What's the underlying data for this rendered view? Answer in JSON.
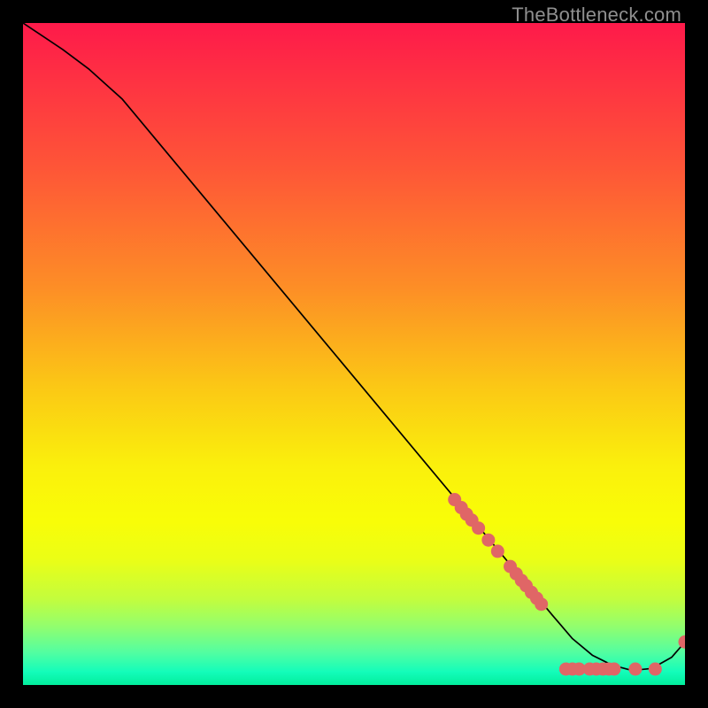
{
  "watermark": "TheBottleneck.com",
  "chart_data": {
    "type": "line",
    "title": "",
    "xlabel": "",
    "ylabel": "",
    "xlim": [
      0,
      100
    ],
    "ylim": [
      0,
      100
    ],
    "grid": false,
    "series": [
      {
        "name": "curve",
        "x": [
          0,
          3,
          6,
          10,
          15,
          20,
          25,
          30,
          35,
          40,
          45,
          50,
          55,
          60,
          65,
          70,
          75,
          80,
          83,
          86,
          89,
          92,
          95,
          98,
          100
        ],
        "y": [
          100,
          98,
          96,
          93,
          88.5,
          82.5,
          76.5,
          70.5,
          64.5,
          58.5,
          52.5,
          46.5,
          40.5,
          34.5,
          28.5,
          22.5,
          16.5,
          10.5,
          7,
          4.5,
          3,
          2.2,
          2.5,
          4.2,
          6.5
        ],
        "stroke": "#000000",
        "stroke_width": 1.7
      }
    ],
    "markers": {
      "color": "#e06666",
      "radius": 7.5,
      "points": [
        {
          "x": 65.2,
          "y": 28.0
        },
        {
          "x": 66.2,
          "y": 26.8
        },
        {
          "x": 67.0,
          "y": 25.8
        },
        {
          "x": 67.8,
          "y": 24.9
        },
        {
          "x": 68.8,
          "y": 23.7
        },
        {
          "x": 70.3,
          "y": 21.9
        },
        {
          "x": 71.7,
          "y": 20.2
        },
        {
          "x": 73.6,
          "y": 17.9
        },
        {
          "x": 74.5,
          "y": 16.8
        },
        {
          "x": 75.3,
          "y": 15.8
        },
        {
          "x": 76.0,
          "y": 15.0
        },
        {
          "x": 76.8,
          "y": 14.0
        },
        {
          "x": 77.6,
          "y": 13.1
        },
        {
          "x": 78.3,
          "y": 12.2
        },
        {
          "x": 82.0,
          "y": 2.4
        },
        {
          "x": 83.0,
          "y": 2.4
        },
        {
          "x": 84.0,
          "y": 2.4
        },
        {
          "x": 85.6,
          "y": 2.4
        },
        {
          "x": 86.6,
          "y": 2.4
        },
        {
          "x": 87.6,
          "y": 2.4
        },
        {
          "x": 88.5,
          "y": 2.4
        },
        {
          "x": 89.3,
          "y": 2.4
        },
        {
          "x": 92.5,
          "y": 2.4
        },
        {
          "x": 95.5,
          "y": 2.4
        },
        {
          "x": 100.0,
          "y": 6.5
        }
      ]
    },
    "background_gradient": {
      "stops": [
        {
          "offset": 0.0,
          "color": "#fe1a4a"
        },
        {
          "offset": 0.22,
          "color": "#fe5637"
        },
        {
          "offset": 0.4,
          "color": "#fd8e26"
        },
        {
          "offset": 0.55,
          "color": "#fbc815"
        },
        {
          "offset": 0.67,
          "color": "#faf00c"
        },
        {
          "offset": 0.75,
          "color": "#f9fd07"
        },
        {
          "offset": 0.81,
          "color": "#ebfe16"
        },
        {
          "offset": 0.87,
          "color": "#c3fd3d"
        },
        {
          "offset": 0.91,
          "color": "#94fe6c"
        },
        {
          "offset": 0.95,
          "color": "#54fea0"
        },
        {
          "offset": 0.98,
          "color": "#14fdba"
        },
        {
          "offset": 1.0,
          "color": "#02ee9c"
        }
      ]
    }
  }
}
